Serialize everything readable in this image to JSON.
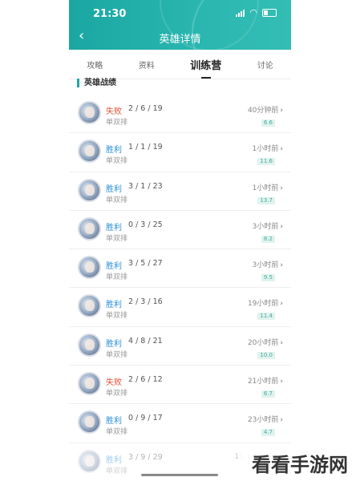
{
  "status_bar": {
    "time": "21:30"
  },
  "header": {
    "title": "英雄详情",
    "back_icon": "chevron-left-icon"
  },
  "tabs": [
    {
      "label": "攻略",
      "active": false
    },
    {
      "label": "资料",
      "active": false
    },
    {
      "label": "训练营",
      "active": true
    },
    {
      "label": "讨论",
      "active": false
    }
  ],
  "section": {
    "title": "英雄战绩"
  },
  "matches": [
    {
      "result": "失败",
      "outcome": "loss",
      "kda": "2 / 6 / 19",
      "mode": "单双排",
      "time": "40分钟前",
      "score": "6.6"
    },
    {
      "result": "胜利",
      "outcome": "win",
      "kda": "1 / 1 / 19",
      "mode": "单双排",
      "time": "1小时前",
      "score": "11.6"
    },
    {
      "result": "胜利",
      "outcome": "win",
      "kda": "3 / 1 / 23",
      "mode": "单双排",
      "time": "1小时前",
      "score": "13.7"
    },
    {
      "result": "胜利",
      "outcome": "win",
      "kda": "0 / 3 / 25",
      "mode": "单双排",
      "time": "3小时前",
      "score": "8.2"
    },
    {
      "result": "胜利",
      "outcome": "win",
      "kda": "3 / 5 / 27",
      "mode": "单双排",
      "time": "3小时前",
      "score": "9.5"
    },
    {
      "result": "胜利",
      "outcome": "win",
      "kda": "2 / 3 / 16",
      "mode": "单双排",
      "time": "19小时前",
      "score": "11.4"
    },
    {
      "result": "胜利",
      "outcome": "win",
      "kda": "4 / 8 / 21",
      "mode": "单双排",
      "time": "20小时前",
      "score": "10.0"
    },
    {
      "result": "失败",
      "outcome": "loss",
      "kda": "2 / 6 / 12",
      "mode": "单双排",
      "time": "21小时前",
      "score": "6.7"
    },
    {
      "result": "胜利",
      "outcome": "win",
      "kda": "0 / 9 / 17",
      "mode": "单双排",
      "time": "23小时前",
      "score": "4.7"
    },
    {
      "result": "胜利",
      "outcome": "win",
      "kda": "3 / 9 / 29",
      "mode": "单双排",
      "time": "11-12 20:48",
      "score": ""
    }
  ],
  "watermark": "看看手游网",
  "colors": {
    "header": "#1fa7a3",
    "win": "#2a8fd6",
    "loss": "#e0533a",
    "score_bg": "#dff3ef"
  }
}
